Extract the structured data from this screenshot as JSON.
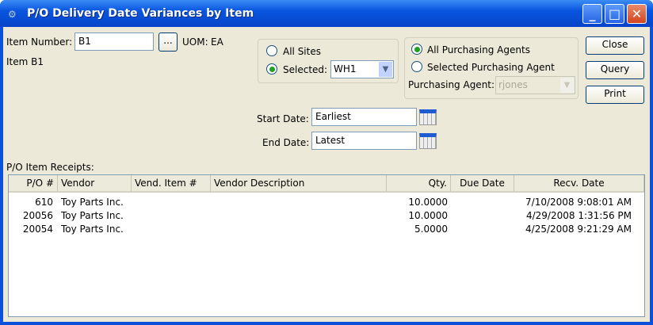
{
  "window": {
    "title": "P/O Delivery Date Variances by Item",
    "minimize": "_",
    "maximize": "□",
    "close": "✕"
  },
  "item": {
    "label": "Item Number:",
    "value": "B1",
    "lookup": "...",
    "uom_label": "UOM:",
    "uom": "EA",
    "description": "Item B1"
  },
  "sites": {
    "all": "All Sites",
    "selected": "Selected:",
    "value": "WH1"
  },
  "agents": {
    "all": "All Purchasing Agents",
    "selected": "Selected Purchasing Agent",
    "agent_label": "Purchasing Agent:",
    "agent_value": "rjones"
  },
  "buttons": {
    "close": "Close",
    "query": "Query",
    "print": "Print"
  },
  "dates": {
    "start_label": "Start Date:",
    "start": "Earliest",
    "end_label": "End Date:",
    "end": "Latest"
  },
  "receipts": {
    "label": "P/O Item Receipts:",
    "columns": [
      "P/O #",
      "Vendor",
      "Vend. Item #",
      "Vendor Description",
      "Qty.",
      "Due Date",
      "Recv. Date"
    ],
    "rows": [
      [
        "610",
        "Toy Parts Inc.",
        "",
        "",
        "10.0000",
        "",
        "7/10/2008 9:08:01 AM"
      ],
      [
        "20056",
        "Toy Parts Inc.",
        "",
        "",
        "10.0000",
        "",
        "4/29/2008 1:31:56 PM"
      ],
      [
        "20054",
        "Toy Parts Inc.",
        "",
        "",
        "5.0000",
        "",
        "4/25/2008 9:21:29 AM"
      ]
    ]
  }
}
